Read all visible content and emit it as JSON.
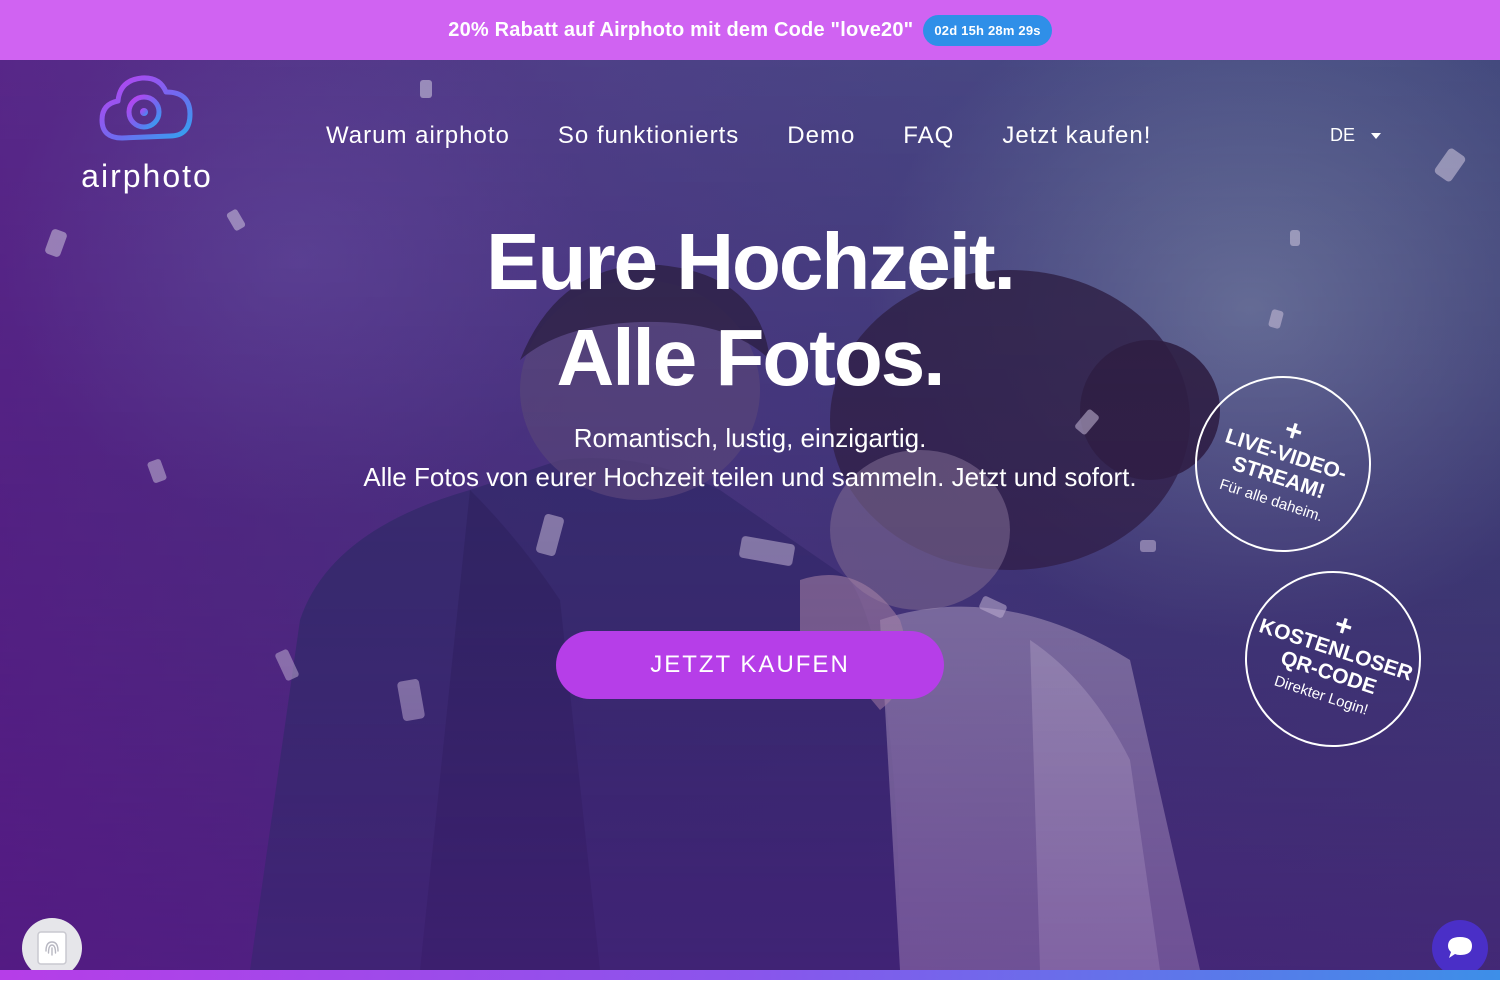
{
  "promo": {
    "text": "20% Rabatt auf Airphoto mit dem Code \"love20\"",
    "countdown": "02d 15h 28m 29s"
  },
  "brand": {
    "name": "airphoto"
  },
  "nav": {
    "items": [
      "Warum airphoto",
      "So funktionierts",
      "Demo",
      "FAQ",
      "Jetzt kaufen!"
    ],
    "language": "DE"
  },
  "hero": {
    "headline_line1": "Eure Hochzeit.",
    "headline_line2": "Alle Fotos.",
    "subline1": "Romantisch, lustig, einzigartig.",
    "subline2": "Alle Fotos von eurer Hochzeit teilen und sammeln. Jetzt und sofort.",
    "cta_label": "JETZT KAUFEN"
  },
  "badges": [
    {
      "plus": "+",
      "title_line1": "LIVE-VIDEO-",
      "title_line2": "STREAM!",
      "subtitle": "Für alle daheim."
    },
    {
      "plus": "+",
      "title_line1": "KOSTENLOSER",
      "title_line2": "QR-CODE",
      "subtitle": "Direkter Login!"
    }
  ],
  "icons": {
    "logo": "camera-cloud-icon",
    "privacy": "fingerprint-icon",
    "chat": "chat-bubble-icon",
    "language_caret": "caret-down-icon"
  },
  "colors": {
    "promo_bg": "#d063f2",
    "countdown_bg": "#2f8fe8",
    "cta_bg": "#b63ee8",
    "chat_bg": "#4a2fc7"
  }
}
